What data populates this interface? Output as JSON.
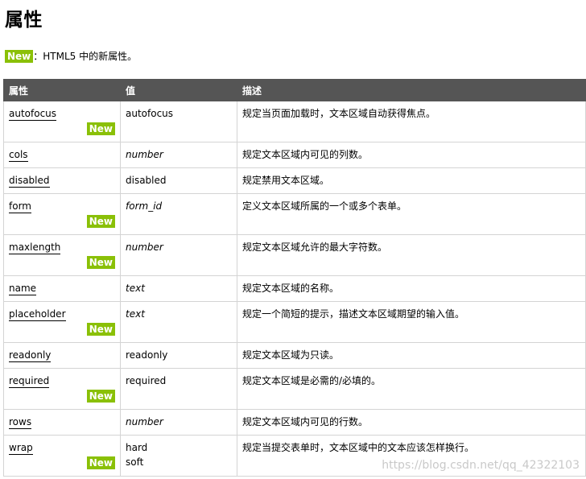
{
  "page": {
    "title": "属性",
    "legend_badge": "New",
    "legend_text": "：HTML5 中的新属性。",
    "watermark": "https://blog.csdn.net/qq_42322103"
  },
  "table": {
    "headers": [
      "属性",
      "值",
      "描述"
    ],
    "badge_label": "New",
    "rows": [
      {
        "attr": "autofocus",
        "new": true,
        "values": [
          "autofocus"
        ],
        "italic": false,
        "desc": "规定当页面加载时，文本区域自动获得焦点。"
      },
      {
        "attr": "cols",
        "new": false,
        "values": [
          "number"
        ],
        "italic": true,
        "desc": "规定文本区域内可见的列数。"
      },
      {
        "attr": "disabled",
        "new": false,
        "values": [
          "disabled"
        ],
        "italic": false,
        "desc": "规定禁用文本区域。"
      },
      {
        "attr": "form",
        "new": true,
        "values": [
          "form_id"
        ],
        "italic": true,
        "desc": "定义文本区域所属的一个或多个表单。"
      },
      {
        "attr": "maxlength",
        "new": true,
        "values": [
          "number"
        ],
        "italic": true,
        "desc": "规定文本区域允许的最大字符数。"
      },
      {
        "attr": "name",
        "new": false,
        "values": [
          "text"
        ],
        "italic": true,
        "desc": "规定文本区域的名称。"
      },
      {
        "attr": "placeholder",
        "new": true,
        "values": [
          "text"
        ],
        "italic": true,
        "desc": "规定一个简短的提示，描述文本区域期望的输入值。"
      },
      {
        "attr": "readonly",
        "new": false,
        "values": [
          "readonly"
        ],
        "italic": false,
        "desc": "规定文本区域为只读。"
      },
      {
        "attr": "required",
        "new": true,
        "values": [
          "required"
        ],
        "italic": false,
        "desc": "规定文本区域是必需的/必填的。"
      },
      {
        "attr": "rows",
        "new": false,
        "values": [
          "number"
        ],
        "italic": true,
        "desc": "规定文本区域内可见的行数。"
      },
      {
        "attr": "wrap",
        "new": true,
        "values": [
          "hard",
          "soft"
        ],
        "italic": false,
        "desc": "规定当提交表单时，文本区域中的文本应该怎样换行。"
      }
    ]
  }
}
